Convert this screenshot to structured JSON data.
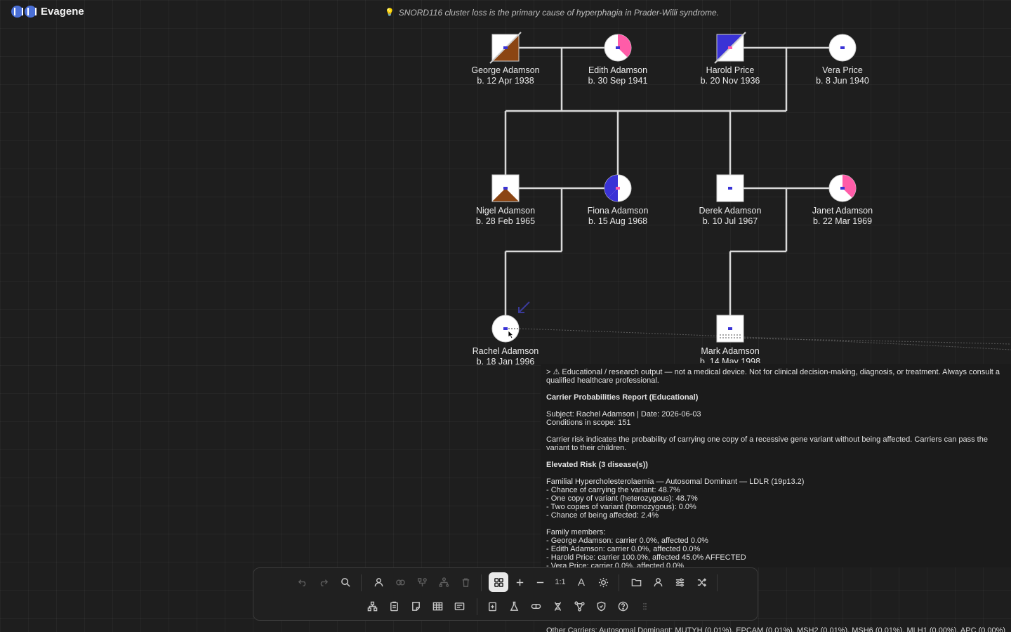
{
  "app": {
    "name": "Evagene"
  },
  "tip": {
    "text": "SNORD116 cluster loss is the primary cause of hyperphagia in Prader-Willi syndrome."
  },
  "people": [
    {
      "id": "george",
      "name": "George Adamson",
      "dob": "b. 12 Apr 1938",
      "sex": "male",
      "deceased": true
    },
    {
      "id": "edith",
      "name": "Edith Adamson",
      "dob": "b. 30 Sep 1941",
      "sex": "female"
    },
    {
      "id": "harold",
      "name": "Harold Price",
      "dob": "b. 20 Nov 1936",
      "sex": "male",
      "deceased": true
    },
    {
      "id": "vera",
      "name": "Vera Price",
      "dob": "b. 8 Jun 1940",
      "sex": "female"
    },
    {
      "id": "nigel",
      "name": "Nigel Adamson",
      "dob": "b. 28 Feb 1965",
      "sex": "male"
    },
    {
      "id": "fiona",
      "name": "Fiona Adamson",
      "dob": "b. 15 Aug 1968",
      "sex": "female"
    },
    {
      "id": "derek",
      "name": "Derek Adamson",
      "dob": "b. 10 Jul 1967",
      "sex": "male"
    },
    {
      "id": "janet",
      "name": "Janet Adamson",
      "dob": "b. 22 Mar 1969",
      "sex": "female"
    },
    {
      "id": "rachel",
      "name": "Rachel Adamson",
      "dob": "b. 18 Jan 1996",
      "sex": "female",
      "proband": true
    },
    {
      "id": "mark",
      "name": "Mark Adamson",
      "dob": "b. 14 May 1998",
      "sex": "male"
    }
  ],
  "colors": {
    "pink": "#ff5ca8",
    "blue": "#3a33d6",
    "brown": "#8b4513",
    "line": "#d9d9d9"
  },
  "report": {
    "disclaimer": "> ⚠ Educational / research output — not a medical device. Not for clinical decision-making, diagnosis, or treatment. Always consult a qualified healthcare professional.",
    "title": "Carrier Probabilities Report (Educational)",
    "subject": "Subject: Rachel Adamson | Date: 2026-06-03",
    "conditions": "Conditions in scope: 151",
    "explanation": "Carrier risk indicates the probability of carrying one copy of a recessive gene variant without being affected. Carriers can pass the variant to their children.",
    "elevated_heading": "Elevated Risk (3 disease(s))",
    "disease_title": "Familial Hypercholesterolaemia — Autosomal Dominant — LDLR (19p13.2)",
    "disease_lines": [
      "- Chance of carrying the variant: 48.7%",
      "- One copy of variant (heterozygous): 48.7%",
      "- Two copies of variant (homozygous): 0.0%",
      "- Chance of being affected: 2.4%"
    ],
    "members_heading": "Family members:",
    "members": [
      "- George Adamson: carrier 0.0%, affected 0.0%",
      "- Edith Adamson: carrier 0.0%, affected 0.0%",
      "- Harold Price: carrier 100.0%, affected 45.0% AFFECTED",
      "- Vera Price: carrier 0.0%, affected 0.0%"
    ],
    "bottom_line": "Other Carriers: Autosomal Dominant: MUTYH (0.01%), EPCAM (0.01%), MSH2 (0.01%), MSH6 (0.01%), MLH1 (0.00%), APC (0.00%)"
  },
  "toolbar": {
    "zoom_reset": "1:1",
    "text_size": "A"
  }
}
